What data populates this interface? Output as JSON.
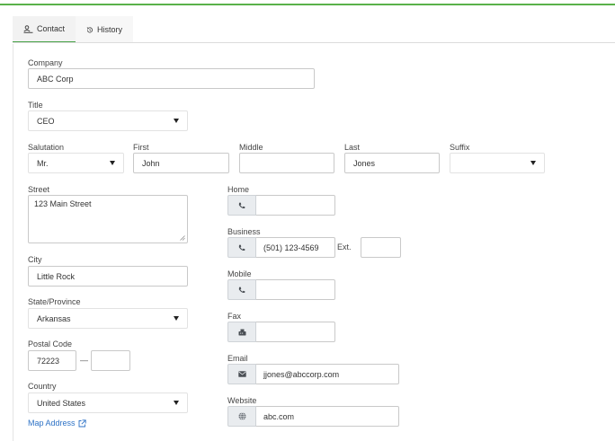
{
  "tabs": [
    {
      "label": "Contact",
      "icon": "contact-card-icon"
    },
    {
      "label": "History",
      "icon": "history-icon"
    }
  ],
  "company": {
    "label": "Company",
    "value": "ABC Corp"
  },
  "title": {
    "label": "Title",
    "value": "CEO"
  },
  "salutation": {
    "label": "Salutation",
    "value": "Mr."
  },
  "first": {
    "label": "First",
    "value": "John"
  },
  "middle": {
    "label": "Middle",
    "value": ""
  },
  "last": {
    "label": "Last",
    "value": "Jones"
  },
  "suffix": {
    "label": "Suffix",
    "value": ""
  },
  "street": {
    "label": "Street",
    "value": "123 Main Street"
  },
  "city": {
    "label": "City",
    "value": "Little Rock"
  },
  "state": {
    "label": "State/Province",
    "value": "Arkansas"
  },
  "postal": {
    "label": "Postal Code",
    "value": "72223",
    "ext_value": "",
    "separator": "—"
  },
  "country": {
    "label": "Country",
    "value": "United States"
  },
  "map_link": "Map Address",
  "home": {
    "label": "Home",
    "value": "",
    "icon": "phone-icon"
  },
  "business": {
    "label": "Business",
    "value": "(501) 123-4569",
    "icon": "phone-icon",
    "ext_label": "Ext.",
    "ext_value": ""
  },
  "mobile": {
    "label": "Mobile",
    "value": "",
    "icon": "phone-icon"
  },
  "fax": {
    "label": "Fax",
    "value": "",
    "icon": "fax-icon"
  },
  "email": {
    "label": "Email",
    "value": "jjones@abccorp.com",
    "icon": "envelope-icon"
  },
  "website": {
    "label": "Website",
    "value": "abc.com",
    "icon": "globe-icon"
  },
  "colors": {
    "accent": "#5ab14a",
    "link": "#2d72c6",
    "addon_bg": "#e9ecef"
  }
}
